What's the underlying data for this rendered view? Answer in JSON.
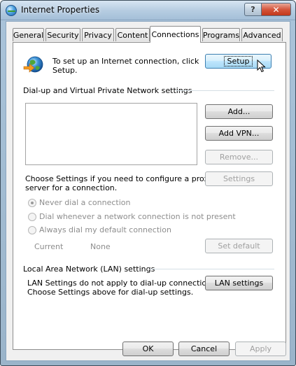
{
  "window": {
    "title": "Internet Properties",
    "help_label": "?",
    "close_label": "✕"
  },
  "tabs": [
    {
      "label": "General"
    },
    {
      "label": "Security"
    },
    {
      "label": "Privacy"
    },
    {
      "label": "Content"
    },
    {
      "label": "Connections"
    },
    {
      "label": "Programs"
    },
    {
      "label": "Advanced"
    }
  ],
  "active_tab": "Connections",
  "setup": {
    "description_line1": "To set up an Internet connection, click",
    "description_line2": "Setup.",
    "button": "Setup"
  },
  "dialup": {
    "heading": "Dial-up and Virtual Private Network settings",
    "add": "Add...",
    "add_vpn": "Add VPN...",
    "remove": "Remove...",
    "settings_text_line1": "Choose Settings if you need to configure a proxy",
    "settings_text_line2": "server for a connection.",
    "settings": "Settings",
    "radios": [
      {
        "label": "Never dial a connection",
        "checked": true
      },
      {
        "label": "Dial whenever a network connection is not present",
        "checked": false
      },
      {
        "label": "Always dial my default connection",
        "checked": false
      }
    ],
    "current_label": "Current",
    "current_value": "None",
    "set_default": "Set default"
  },
  "lan": {
    "heading": "Local Area Network (LAN) settings",
    "text_line1": "LAN Settings do not apply to dial-up connections.",
    "text_line2": "Choose Settings above for dial-up settings.",
    "button": "LAN settings"
  },
  "footer": {
    "ok": "OK",
    "cancel": "Cancel",
    "apply": "Apply"
  },
  "colors": {
    "focus_blue": "#3c7fb1",
    "close_red": "#c1371a",
    "disabled_text": "#a0a0a0"
  }
}
